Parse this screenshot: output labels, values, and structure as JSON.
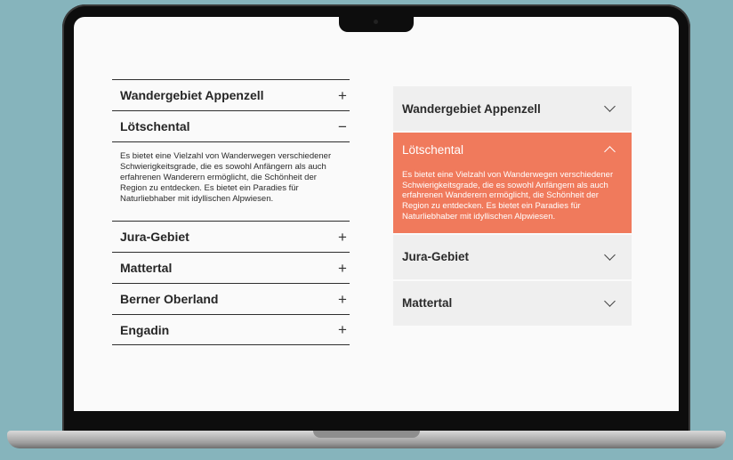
{
  "left_accordion": {
    "items": [
      {
        "label": "Wandergebiet Appenzell",
        "sign": "+"
      },
      {
        "label": "Lötschental",
        "sign": "−",
        "body": "Es bietet eine Vielzahl von Wanderwegen verschiedener Schwierigkeitsgrade, die es sowohl Anfängern als auch erfahrenen Wanderern ermöglicht, die Schönheit der Region zu entdecken. Es bietet ein Paradies für Naturliebhaber mit idyllischen Alpwiesen."
      },
      {
        "label": "Jura-Gebiet",
        "sign": "+"
      },
      {
        "label": "Mattertal",
        "sign": "+"
      },
      {
        "label": "Berner Oberland",
        "sign": "+"
      },
      {
        "label": "Engadin",
        "sign": "+"
      }
    ]
  },
  "right_accordion": {
    "items": [
      {
        "label": "Wandergebiet Appenzell"
      },
      {
        "label": "Lötschental",
        "body": "Es bietet eine Vielzahl von Wanderwegen verschiedener Schwierigkeitsgrade, die es sowohl Anfängern als auch erfahrenen Wanderern ermöglicht, die Schönheit der Region zu entdecken. Es bietet ein Paradies für Naturliebhaber mit idyllischen Alpwiesen."
      },
      {
        "label": "Jura-Gebiet"
      },
      {
        "label": "Mattertal"
      }
    ]
  },
  "colors": {
    "background": "#86b4bc",
    "accent": "#f07a5c",
    "panel": "#efefef"
  }
}
